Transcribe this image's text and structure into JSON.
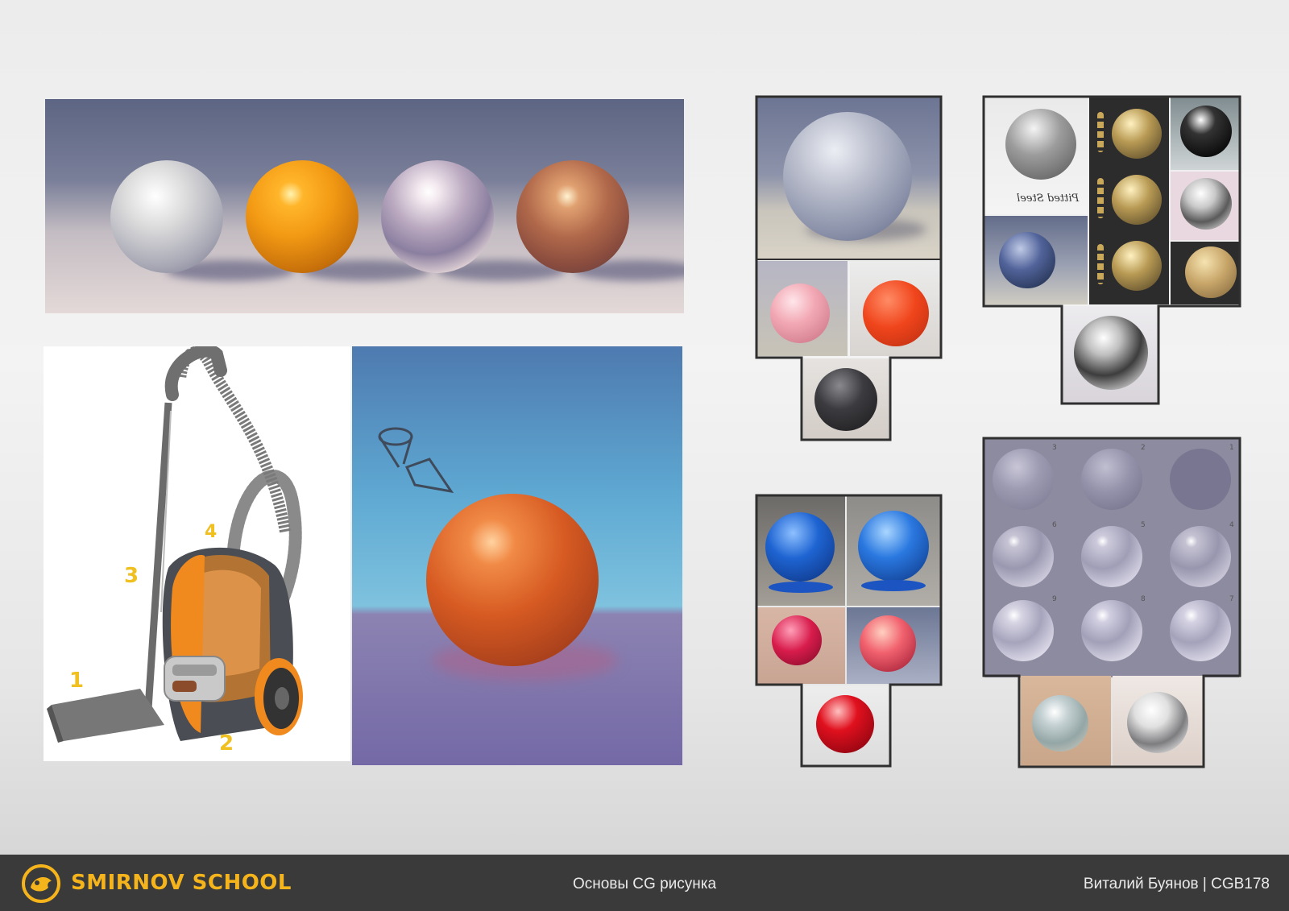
{
  "footer": {
    "brand": "SMIRNOV SCHOOL",
    "course": "Основы CG рисунка",
    "author": "Виталий Буянов | CGB178",
    "bar_color": "#3a3a3a",
    "accent": "#f5b41c"
  },
  "panels": {
    "four_spheres": {
      "materials": [
        "matte-white",
        "glossy-orange",
        "chrome",
        "copper"
      ]
    },
    "vacuum": {
      "annotations": [
        "1",
        "2",
        "3",
        "4"
      ],
      "accent": "#f08a1e"
    },
    "orange_sphere_study": {
      "icon": "cone-light-direction-icon"
    },
    "metals_reference": {
      "signature": "Pitted Steel"
    },
    "glass_study": {
      "numbers": [
        "3",
        "2",
        "1",
        "6",
        "5",
        "4",
        "9",
        "8",
        "7"
      ]
    }
  }
}
